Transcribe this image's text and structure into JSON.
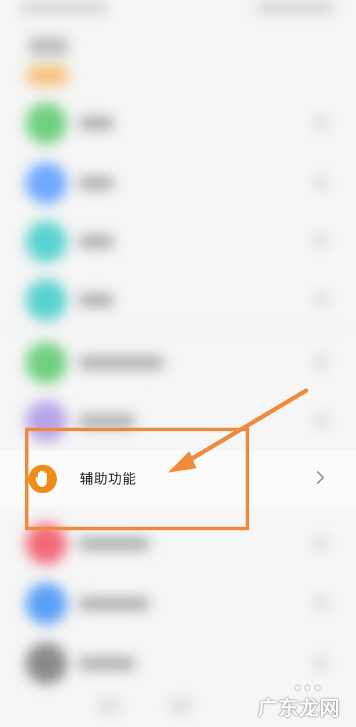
{
  "settings_item": {
    "label": "辅助功能",
    "icon": "hand-icon",
    "icon_color": "#f08c1c"
  },
  "annotation": {
    "color": "#f08a3c"
  },
  "watermark": {
    "text": "广东龙网"
  }
}
